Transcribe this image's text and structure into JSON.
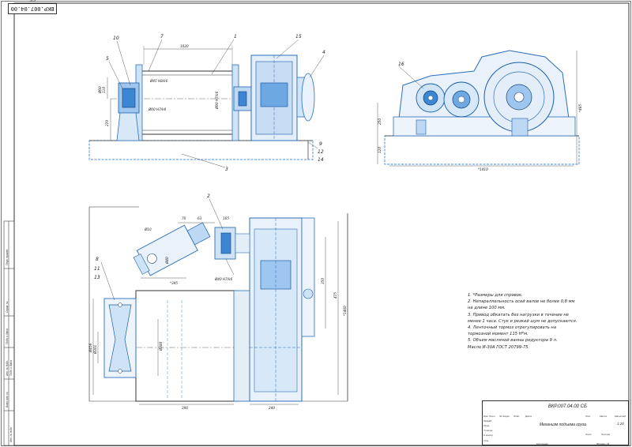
{
  "sheet": {
    "corner_code": "ВКР.007.04.00 СБ"
  },
  "callouts": {
    "top_view": [
      "10",
      "7",
      "1",
      "15",
      "4",
      "5",
      "16",
      "9",
      "12",
      "14",
      "3"
    ],
    "plan_view": [
      "2",
      "8",
      "11",
      "13"
    ]
  },
  "dimensions": {
    "top_view": [
      "1020",
      "Ø45 H8/k6",
      "Ø60 H7/k6",
      "Ø90 H7/k6",
      "270",
      "110",
      "Ø60"
    ],
    "right_view": [
      "250",
      "120",
      "*1410",
      "*485"
    ],
    "plan_view": [
      "70",
      "63",
      "165",
      "Ø10",
      "Ø40",
      "Ø40 H7/k6",
      "*345",
      "Ø456",
      "Ø301",
      "Ø380",
      "350",
      "475",
      "*1460",
      "396",
      "240"
    ]
  },
  "notes": [
    "1. *Размеры для справок.",
    "2. Непараллельность осей валов не более 0,8 мм",
    "на длине 100 мм.",
    "3. Привод обкатать без нагрузки в течение не",
    "менее 1 часа. Стук и резкий шум не допускаются.",
    "4. Ленточный тормоз отрегулировать на",
    "тормозной момент 115 Н*м.",
    "5. Объем масляной ванны редуктора 9 л.",
    "Масло И-30А ГОСТ 20799-75."
  ],
  "title_block": {
    "code": "ВКР.007.04.00 СБ",
    "name": "Механизм подъема груза",
    "scale": "1:20",
    "col_lit": "Лит.",
    "col_mass": "Масса",
    "col_scale": "Масштаб",
    "sheet": "Лист",
    "sheets": "Листов",
    "rows": [
      "Изм.",
      "Лист",
      "№ докум.",
      "Подп.",
      "Дата",
      "Разраб.",
      "Пров.",
      "Т.контр.",
      "Н.контр.",
      "Утв."
    ],
    "copy": "Копировал",
    "format": "Формат  А1"
  },
  "side_strip": [
    "Перв. примен.",
    "Справ. №",
    "Подп. и дата",
    "Инв. № дубл.",
    "Взам. инв. №",
    "Подп. и дата",
    "Инв. № подл."
  ]
}
